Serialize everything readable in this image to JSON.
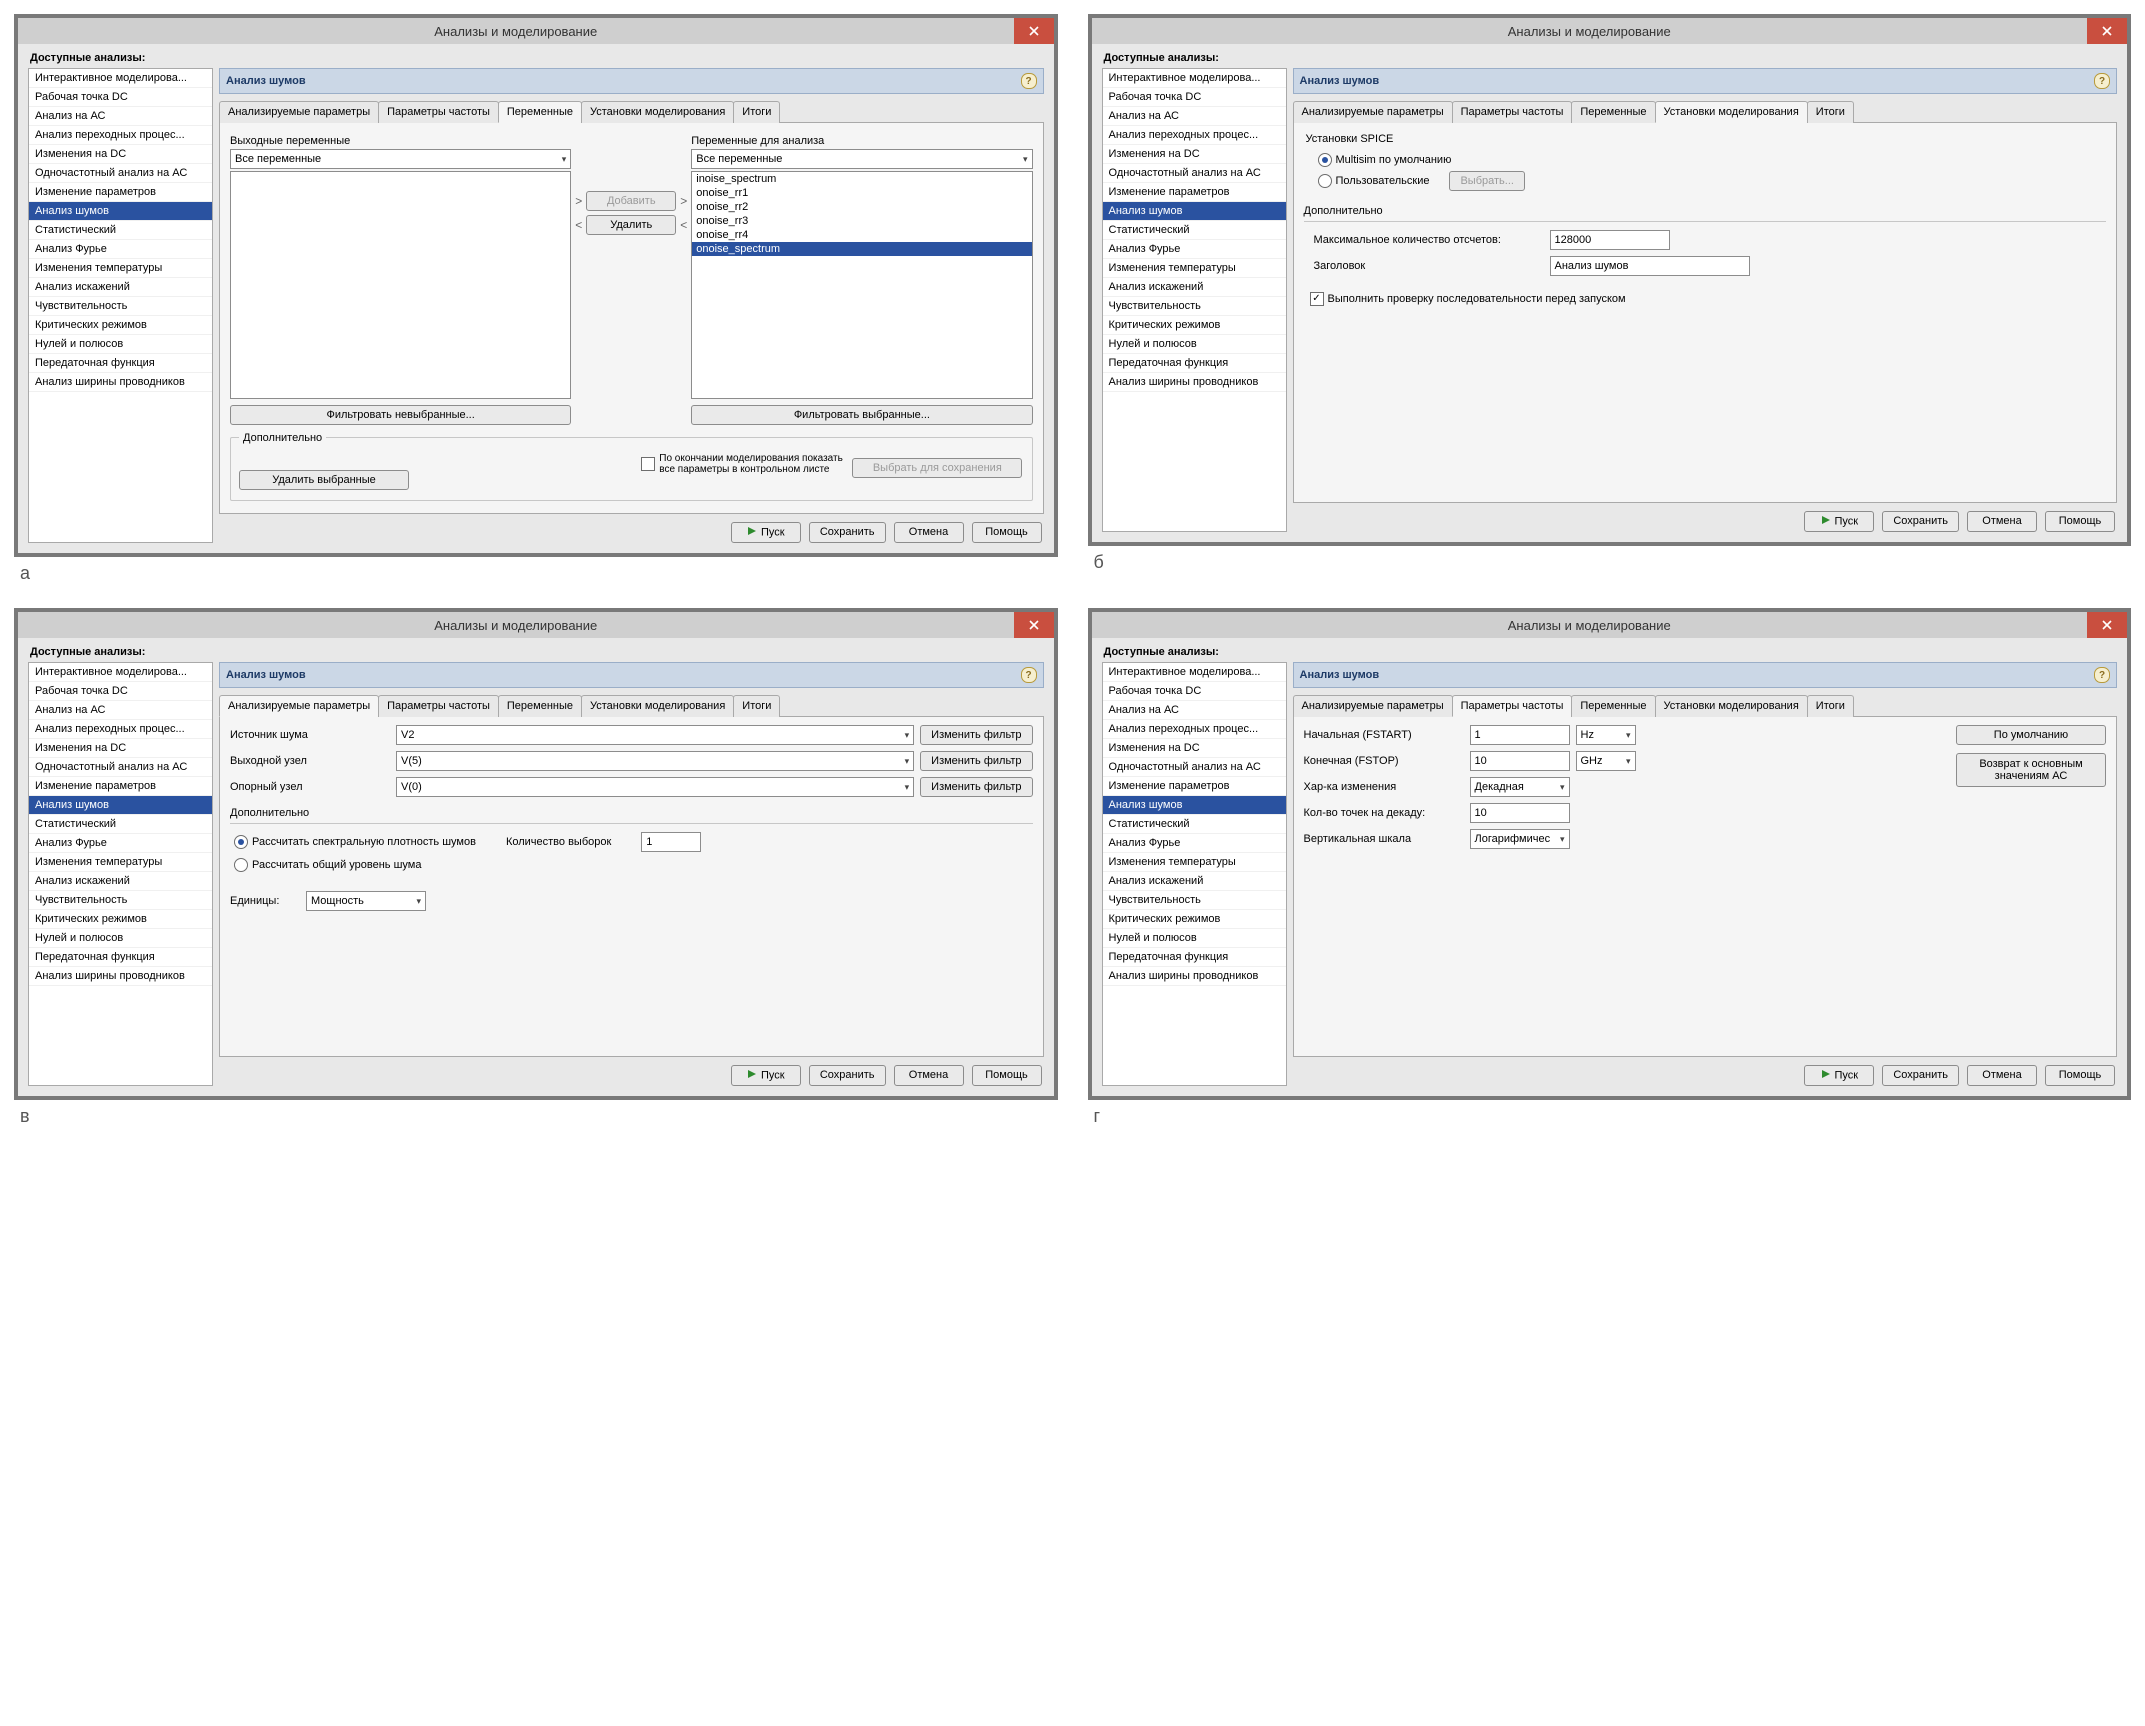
{
  "window_title": "Анализы и моделирование",
  "available_label": "Доступные анализы:",
  "pane_title": "Анализ шумов",
  "help_q": "?",
  "sidebar": [
    "Интерактивное моделирова...",
    "Рабочая точка DC",
    "Анализ на АС",
    "Анализ переходных процес...",
    "Изменения на DC",
    "Одночастотный анализ на АС",
    "Изменение параметров",
    "Анализ шумов",
    "Статистический",
    "Анализ Фурье",
    "Изменения температуры",
    "Анализ искажений",
    "Чувствительность",
    "Критических режимов",
    "Нулей и полюсов",
    "Передаточная функция",
    "Анализ ширины проводников"
  ],
  "selected_index": 7,
  "tabs": [
    "Анализируемые параметры",
    "Параметры частоты",
    "Переменные",
    "Установки моделирования",
    "Итоги"
  ],
  "footer": {
    "run": "Пуск",
    "save": "Сохранить",
    "cancel": "Отмена",
    "help": "Помощь"
  },
  "panelA": {
    "out_vars_title": "Выходные переменные",
    "out_vars_dd": "Все переменные",
    "anal_vars_title": "Переменные для анализа",
    "anal_vars_dd": "Все переменные",
    "anal_vars_list": [
      "inoise_spectrum",
      "onoise_rr1",
      "onoise_rr2",
      "onoise_rr3",
      "onoise_rr4",
      "onoise_spectrum"
    ],
    "selected_list_index": 5,
    "add": "Добавить",
    "remove": "Удалить",
    "filter_unsel": "Фильтровать невыбранные...",
    "filter_sel": "Фильтровать выбранные...",
    "extra": "Дополнительно",
    "del_selected": "Удалить выбранные",
    "chk_show_label": "По окончании моделирования показать все параметры в контрольном листе",
    "save_for": "Выбрать для сохранения"
  },
  "panelB": {
    "spice_title": "Установки SPICE",
    "radio_default": "Multisim по умолчанию",
    "radio_custom": "Пользовательские",
    "choose": "Выбрать...",
    "extra": "Дополнительно",
    "max_samples_lbl": "Максимальное количество отсчетов:",
    "max_samples_val": "128000",
    "title_lbl": "Заголовок",
    "title_val": "Анализ шумов",
    "chk_order": "Выполнить проверку последовательности перед запуском"
  },
  "panelC": {
    "noise_src_lbl": "Источник шума",
    "noise_src_val": "V2",
    "out_node_lbl": "Выходной узел",
    "out_node_val": "V(5)",
    "ref_node_lbl": "Опорный узел",
    "ref_node_val": "V(0)",
    "change_filter": "Изменить фильтр",
    "extra": "Дополнительно",
    "radio_spectral": "Рассчитать спектральную плотность шумов",
    "samples_lbl": "Количество выборок",
    "samples_val": "1",
    "radio_total": "Рассчитать общий уровень шума",
    "units_lbl": "Единицы:",
    "units_val": "Мощность"
  },
  "panelD": {
    "fstart_lbl": "Начальная (FSTART)",
    "fstart_val": "1",
    "fstart_unit": "Hz",
    "fstop_lbl": "Конечная (FSTOP)",
    "fstop_val": "10",
    "fstop_unit": "GHz",
    "sweep_lbl": "Хар-ка изменения",
    "sweep_val": "Декадная",
    "pts_lbl": "Кол-во точек на декаду:",
    "pts_val": "10",
    "vscale_lbl": "Вертикальная шкала",
    "vscale_val": "Логарифмичес",
    "btn_default": "По умолчанию",
    "btn_reset": "Возврат к основным значениям АС"
  },
  "figs": {
    "a": "а",
    "b": "б",
    "c": "в",
    "d": "г"
  }
}
